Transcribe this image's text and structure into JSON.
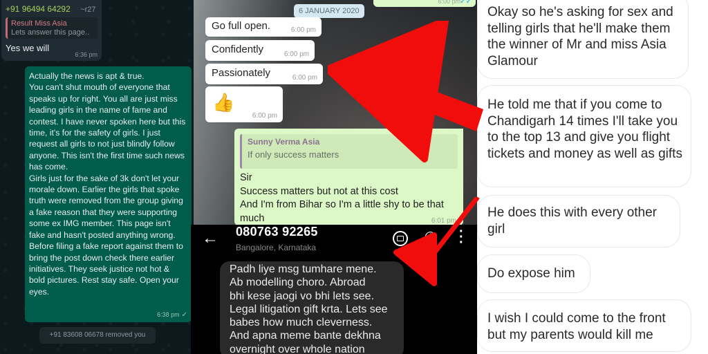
{
  "panel_dark_whatsapp": {
    "incoming": {
      "sender_number": "+91 96494 64292",
      "sender_alias": "~r27",
      "quote_author": "Result Miss Asia",
      "quote_text": "Lets answer this page..",
      "text": "Yes we will",
      "time": "6:36 pm"
    },
    "outgoing": {
      "text": "Actually the news is apt & true.\nYou can't shut mouth of everyone that speaks up for right. You all are just miss leading girls in the name of fame and contest. I have never spoken here but this time, it's for the safety of girls. I just request all girls to not just blindly follow anyone. This isn't the first time such news has come.\nGirls just for the sake of 3k don't let your morale down. Earlier the girls that spoke truth were removed from the group giving a fake reason that they were supporting some ex IMG member. This page isn't fake and hasn't posted anything wrong. Before filing a fake report against them to bring the post down check there earlier initiatives. They seek justice not hot & bold pictures. Rest stay safe. Open your eyes.",
      "time": "6:38 pm",
      "status_icon": "✓"
    },
    "system_message": "+91 83608 06678 removed you"
  },
  "panel_light_whatsapp": {
    "top_cut_time": "6:00 pm",
    "top_cut_status": "✓✓",
    "date_chip": "6 JANUARY 2020",
    "incoming": [
      {
        "text": "Go full open.",
        "time": "6:00 pm"
      },
      {
        "text": "Confidently",
        "time": "6:00 pm"
      },
      {
        "text": "Passionately",
        "time": "6:00 pm"
      },
      {
        "text": "👍",
        "time": "6:00 pm"
      }
    ],
    "outgoing": {
      "quote_author": "Sunny Verma Asia",
      "quote_text": "If only success matters",
      "text": "Sir\nSuccess matters but not at this cost\nAnd I'm from Bihar so I'm a little shy to be that much",
      "time": "6:01 pm"
    }
  },
  "panel_sms": {
    "back_icon": "←",
    "contact_number": "080763 92265",
    "contact_location": "Bangalore, Karnataka",
    "phone_icon": "✆",
    "more_icon": "⋮",
    "message": "Padh liye msg tumhare mene.\nAb modelling choro. Abroad\nbhi kese jaogi vo bhi lets see.\nLegal litigation gift krta. Lets see\nbabes how much cleverness.\nAnd apna meme bante dekhna\novernight over whole nation"
  },
  "panel_instagram": {
    "messages": [
      "Okay so he's asking for sex and telling girls that he'll make them the winner of Mr and miss Asia Glamour",
      "He told me that if you come to Chandigarh 14 times I'll take you to the top 13 and give you flight tickets and money as well as gifts",
      "He does this with every other girl",
      "Do expose him",
      "I wish I could come to the front but my parents would kill me"
    ]
  },
  "annotation_color": "#f20d0d"
}
